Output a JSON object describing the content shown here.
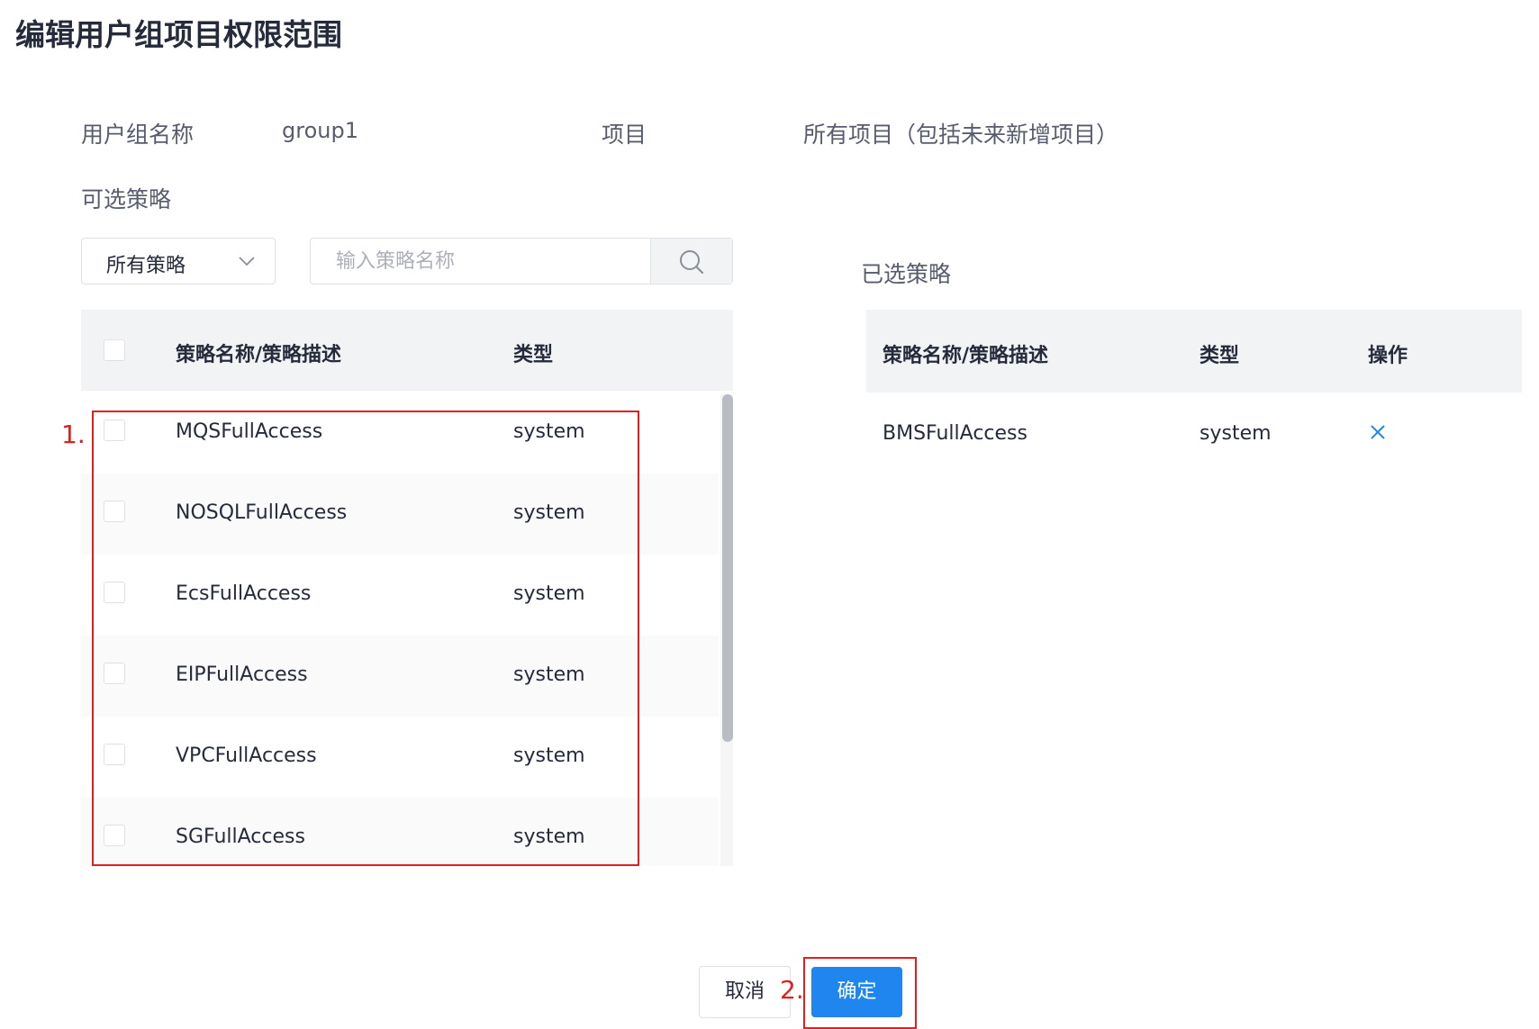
{
  "page": {
    "title": "编辑用户组项目权限范围"
  },
  "info": {
    "group_label": "用户组名称",
    "group_value": "group1",
    "project_label": "项目",
    "project_value": "所有项目（包括未来新增项目）"
  },
  "available": {
    "label": "可选策略",
    "filter_selected": "所有策略",
    "search_placeholder": "输入策略名称",
    "col_name": "策略名称/策略描述",
    "col_type": "类型",
    "rows": [
      {
        "name": "MQSFullAccess",
        "type": "system"
      },
      {
        "name": "NOSQLFullAccess",
        "type": "system"
      },
      {
        "name": "EcsFullAccess",
        "type": "system"
      },
      {
        "name": "EIPFullAccess",
        "type": "system"
      },
      {
        "name": "VPCFullAccess",
        "type": "system"
      },
      {
        "name": "SGFullAccess",
        "type": "system"
      }
    ]
  },
  "selected": {
    "label": "已选策略",
    "col_name": "策略名称/策略描述",
    "col_type": "类型",
    "col_action": "操作",
    "rows": [
      {
        "name": "BMSFullAccess",
        "type": "system"
      }
    ]
  },
  "annotations": {
    "step1": "1.",
    "step2": "2."
  },
  "footer": {
    "cancel_label": "取消",
    "confirm_label": "确定"
  },
  "colors": {
    "primary": "#1f86f0",
    "annotation_red": "#e02020",
    "header_bg": "#f2f3f5"
  }
}
